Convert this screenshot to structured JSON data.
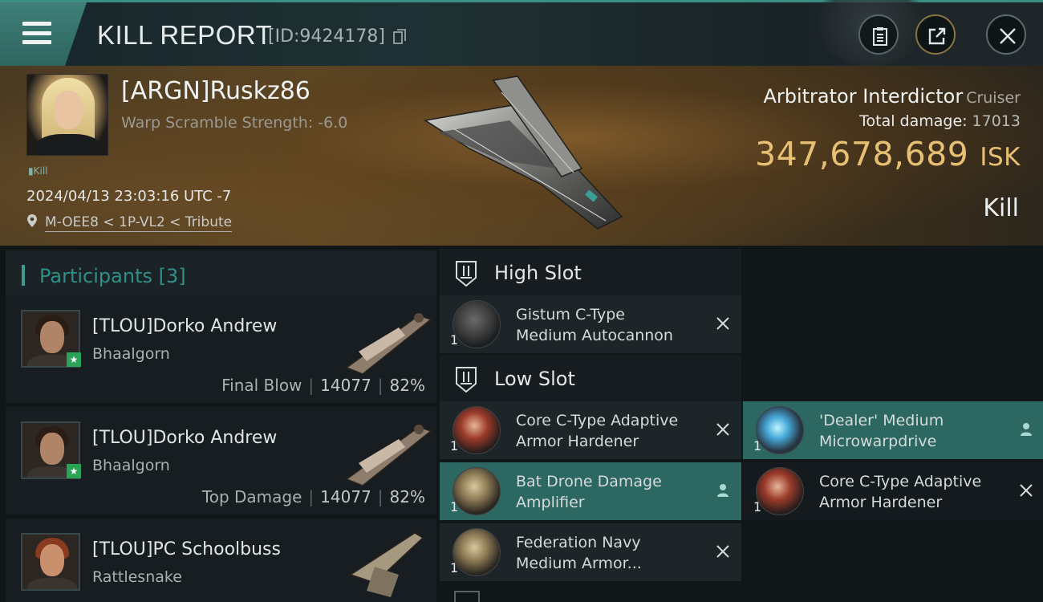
{
  "header": {
    "title": "KILL REPORT",
    "report_id": "[ID:9424178]",
    "menu_icon": "hamburger-menu-icon",
    "buttons": [
      {
        "icon": "clipboard-icon"
      },
      {
        "icon": "share-export-icon"
      },
      {
        "icon": "close-icon"
      }
    ]
  },
  "victim": {
    "pilot": "[ARGN]Ruskz86",
    "warp_scramble": "Warp Scramble Strength: -6.0",
    "kill_mini_label": "Kill",
    "datetime": "2024/04/13 23:03:16 UTC -7",
    "location": "M-OEE8 < 1P-VL2 < Tribute",
    "ship_name": "Arbitrator Interdictor",
    "ship_class": "Cruiser",
    "total_damage_label": "Total damage:",
    "total_damage": "17013",
    "isk_value": "347,678,689",
    "isk_unit": "ISK",
    "result": "Kill"
  },
  "participants": {
    "label": "Participants",
    "count": "[3]",
    "rows": [
      {
        "name": "[TLOU]Dorko Andrew",
        "ship": "Bhaalgorn",
        "role": "Final Blow",
        "damage": "14077",
        "percent": "82%"
      },
      {
        "name": "[TLOU]Dorko Andrew",
        "ship": "Bhaalgorn",
        "role": "Top Damage",
        "damage": "14077",
        "percent": "82%"
      },
      {
        "name": "[TLOU]PC Schoolbuss",
        "ship": "Rattlesnake"
      }
    ]
  },
  "slots": {
    "high": {
      "label": "High Slot",
      "items": [
        {
          "qty": "1",
          "name": "Gistum C-Type\nMedium Autocannon",
          "state": "destroyed"
        }
      ]
    },
    "low": {
      "label": "Low Slot",
      "items": [
        {
          "qty": "1",
          "name": "Core C-Type Adaptive\n Armor Hardener",
          "state": "destroyed"
        },
        {
          "qty": "1",
          "name": "'Dealer' Medium\nMicrowarpdrive",
          "state": "dropped"
        },
        {
          "qty": "1",
          "name": "Bat Drone Damage\nAmplifier",
          "state": "dropped"
        },
        {
          "qty": "1",
          "name": "Core C-Type Adaptive\n Armor Hardener",
          "state": "destroyed"
        },
        {
          "qty": "1",
          "name": "Federation Navy\nMedium Armor...",
          "state": "destroyed"
        }
      ]
    }
  }
}
